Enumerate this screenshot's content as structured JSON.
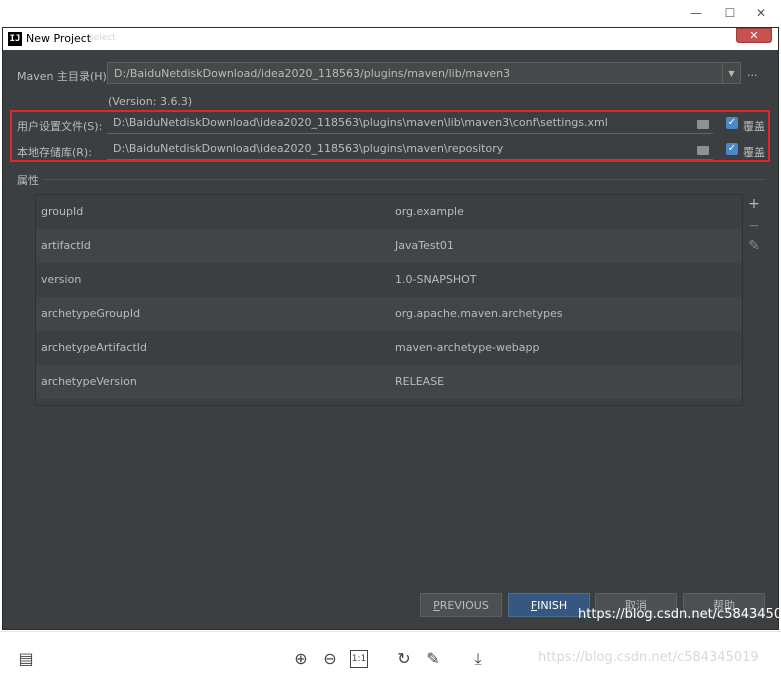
{
  "window_controls": {
    "minimize": "—",
    "maximize": "☐",
    "close": "✕"
  },
  "dialog": {
    "title": "New Project",
    "title_blurred": "select",
    "close": "✕",
    "logo": "IJ"
  },
  "maven": {
    "home_label": "Maven 主目录(H):",
    "home_value": "D:/BaiduNetdiskDownload/idea2020_118563/plugins/maven/lib/maven3",
    "browse": "...",
    "version": "(Version: 3.6.3)",
    "user_settings_label": "用户设置文件(S):",
    "user_settings_value": "D:\\BaiduNetdiskDownload\\idea2020_118563\\plugins\\maven\\lib\\maven3\\conf\\settings.xml",
    "local_repo_label": "本地存储库(R):",
    "local_repo_value": "D:\\BaiduNetdiskDownload\\idea2020_118563\\plugins\\maven\\repository",
    "override_label": "覆盖",
    "check": "✓"
  },
  "properties": {
    "section_title": "属性",
    "rows": [
      {
        "key": "groupId",
        "value": "org.example"
      },
      {
        "key": "artifactId",
        "value": "JavaTest01"
      },
      {
        "key": "version",
        "value": "1.0-SNAPSHOT"
      },
      {
        "key": "archetypeGroupId",
        "value": "org.apache.maven.archetypes"
      },
      {
        "key": "archetypeArtifactId",
        "value": "maven-archetype-webapp"
      },
      {
        "key": "archetypeVersion",
        "value": "RELEASE"
      }
    ],
    "add": "+",
    "remove": "−",
    "edit": "✎"
  },
  "buttons": {
    "previous_first": "P",
    "previous_rest": "REVIOUS",
    "finish_first": "F",
    "finish_rest": "INISH",
    "cancel": "取消",
    "help": "帮助"
  },
  "watermark": "https://blog.csdn.net/c584345019",
  "toolbar": {
    "zoom_in": "⊕",
    "zoom_out": "⊖",
    "actual_size": "1:1",
    "rotate": "↻",
    "edit": "✎",
    "download": "⤓"
  }
}
